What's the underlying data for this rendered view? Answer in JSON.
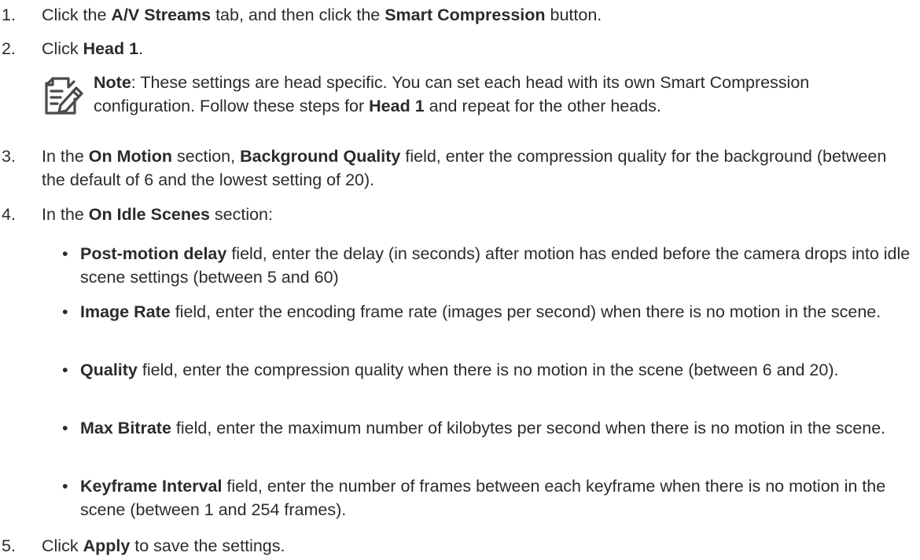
{
  "steps": [
    {
      "num": "1.",
      "pre": "Click the ",
      "b1": "A/V Streams",
      "mid": " tab, and then click the ",
      "b2": "Smart Compression",
      "post": " button."
    },
    {
      "num": "2.",
      "pre": "Click ",
      "b1": "Head 1",
      "post": "."
    },
    {
      "num": "3.",
      "pre": "In the ",
      "b1": "On Motion",
      "mid": " section, ",
      "b2": "Background Quality",
      "post": " field, enter the compression quality for the background (between the default of 6 and the lowest setting of 20)."
    },
    {
      "num": "4.",
      "pre": "In the ",
      "b1": "On Idle Scenes",
      "post": " section:"
    },
    {
      "num": "5.",
      "pre": "Click ",
      "b1": "Apply",
      "post": " to save the settings."
    }
  ],
  "note": {
    "label": "Note",
    "text_a": ": These settings are head specific. You can set each head with its own Smart Compression configuration. Follow these steps for ",
    "bold": "Head 1",
    "text_b": " and repeat for the other heads.",
    "icon": "note-pencil-icon"
  },
  "bullets": [
    {
      "b": "Post-motion delay",
      "t": " field, enter the delay (in seconds) after motion has ended before the camera drops into idle scene settings (between 5 and 60)"
    },
    {
      "b": "Image Rate",
      "t": " field, enter the encoding frame rate (images per second) when there is no motion in the scene."
    },
    {
      "b": "Quality",
      "t": " field, enter the compression quality when there is no motion in the scene (between 6 and 20)."
    },
    {
      "b": "Max Bitrate",
      "t": " field, enter the maximum number of kilobytes per second when there is no motion in the scene."
    },
    {
      "b": " Keyframe Interval",
      "t": " field, enter the number of frames between each keyframe when there is no motion in the scene (between 1 and 254 frames)."
    }
  ],
  "bullet_char": "•"
}
